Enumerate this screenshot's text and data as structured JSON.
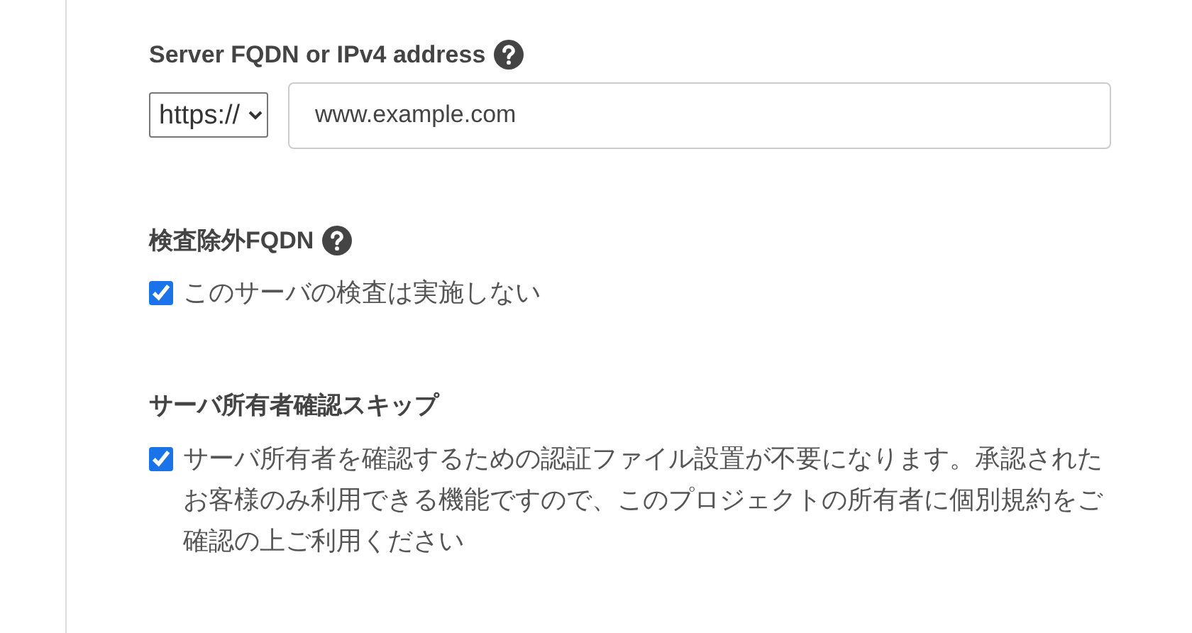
{
  "fields": [
    {
      "kind": "url",
      "label": "Server FQDN or IPv4 address",
      "help": true,
      "scheme": "https://",
      "value": "www.example.com"
    },
    {
      "kind": "checkbox",
      "label": "検査除外FQDN",
      "help": true,
      "checked": true,
      "text": "このサーバの検査は実施しない"
    },
    {
      "kind": "checkbox",
      "label": "サーバ所有者確認スキップ",
      "checked": true,
      "text": "サーバ所有者を確認するための認証ファイル設置が不要になります。承認されたお客様のみ利用できる機能ですので、このプロジェクトの所有者に個別規約をご確認の上ご利用ください"
    }
  ]
}
